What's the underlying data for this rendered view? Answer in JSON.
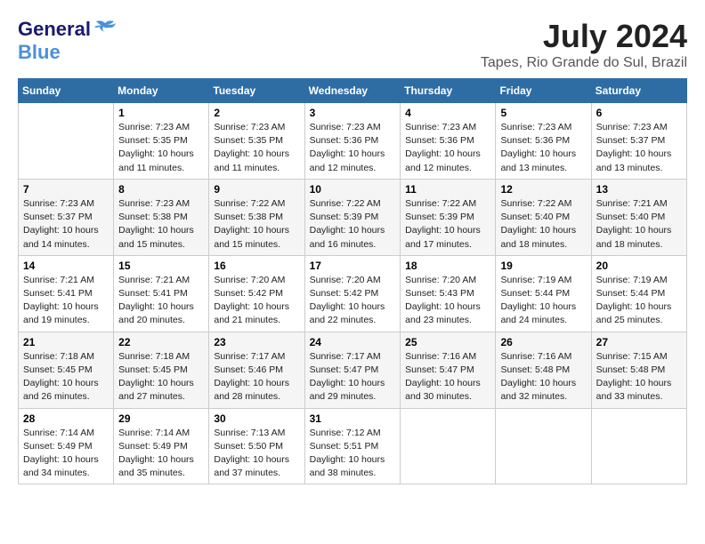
{
  "header": {
    "logo_general": "General",
    "logo_blue": "Blue",
    "month_year": "July 2024",
    "location": "Tapes, Rio Grande do Sul, Brazil"
  },
  "columns": [
    "Sunday",
    "Monday",
    "Tuesday",
    "Wednesday",
    "Thursday",
    "Friday",
    "Saturday"
  ],
  "weeks": [
    [
      {
        "day": "",
        "info": ""
      },
      {
        "day": "1",
        "info": "Sunrise: 7:23 AM\nSunset: 5:35 PM\nDaylight: 10 hours\nand 11 minutes."
      },
      {
        "day": "2",
        "info": "Sunrise: 7:23 AM\nSunset: 5:35 PM\nDaylight: 10 hours\nand 11 minutes."
      },
      {
        "day": "3",
        "info": "Sunrise: 7:23 AM\nSunset: 5:36 PM\nDaylight: 10 hours\nand 12 minutes."
      },
      {
        "day": "4",
        "info": "Sunrise: 7:23 AM\nSunset: 5:36 PM\nDaylight: 10 hours\nand 12 minutes."
      },
      {
        "day": "5",
        "info": "Sunrise: 7:23 AM\nSunset: 5:36 PM\nDaylight: 10 hours\nand 13 minutes."
      },
      {
        "day": "6",
        "info": "Sunrise: 7:23 AM\nSunset: 5:37 PM\nDaylight: 10 hours\nand 13 minutes."
      }
    ],
    [
      {
        "day": "7",
        "info": "Sunrise: 7:23 AM\nSunset: 5:37 PM\nDaylight: 10 hours\nand 14 minutes."
      },
      {
        "day": "8",
        "info": "Sunrise: 7:23 AM\nSunset: 5:38 PM\nDaylight: 10 hours\nand 15 minutes."
      },
      {
        "day": "9",
        "info": "Sunrise: 7:22 AM\nSunset: 5:38 PM\nDaylight: 10 hours\nand 15 minutes."
      },
      {
        "day": "10",
        "info": "Sunrise: 7:22 AM\nSunset: 5:39 PM\nDaylight: 10 hours\nand 16 minutes."
      },
      {
        "day": "11",
        "info": "Sunrise: 7:22 AM\nSunset: 5:39 PM\nDaylight: 10 hours\nand 17 minutes."
      },
      {
        "day": "12",
        "info": "Sunrise: 7:22 AM\nSunset: 5:40 PM\nDaylight: 10 hours\nand 18 minutes."
      },
      {
        "day": "13",
        "info": "Sunrise: 7:21 AM\nSunset: 5:40 PM\nDaylight: 10 hours\nand 18 minutes."
      }
    ],
    [
      {
        "day": "14",
        "info": "Sunrise: 7:21 AM\nSunset: 5:41 PM\nDaylight: 10 hours\nand 19 minutes."
      },
      {
        "day": "15",
        "info": "Sunrise: 7:21 AM\nSunset: 5:41 PM\nDaylight: 10 hours\nand 20 minutes."
      },
      {
        "day": "16",
        "info": "Sunrise: 7:20 AM\nSunset: 5:42 PM\nDaylight: 10 hours\nand 21 minutes."
      },
      {
        "day": "17",
        "info": "Sunrise: 7:20 AM\nSunset: 5:42 PM\nDaylight: 10 hours\nand 22 minutes."
      },
      {
        "day": "18",
        "info": "Sunrise: 7:20 AM\nSunset: 5:43 PM\nDaylight: 10 hours\nand 23 minutes."
      },
      {
        "day": "19",
        "info": "Sunrise: 7:19 AM\nSunset: 5:44 PM\nDaylight: 10 hours\nand 24 minutes."
      },
      {
        "day": "20",
        "info": "Sunrise: 7:19 AM\nSunset: 5:44 PM\nDaylight: 10 hours\nand 25 minutes."
      }
    ],
    [
      {
        "day": "21",
        "info": "Sunrise: 7:18 AM\nSunset: 5:45 PM\nDaylight: 10 hours\nand 26 minutes."
      },
      {
        "day": "22",
        "info": "Sunrise: 7:18 AM\nSunset: 5:45 PM\nDaylight: 10 hours\nand 27 minutes."
      },
      {
        "day": "23",
        "info": "Sunrise: 7:17 AM\nSunset: 5:46 PM\nDaylight: 10 hours\nand 28 minutes."
      },
      {
        "day": "24",
        "info": "Sunrise: 7:17 AM\nSunset: 5:47 PM\nDaylight: 10 hours\nand 29 minutes."
      },
      {
        "day": "25",
        "info": "Sunrise: 7:16 AM\nSunset: 5:47 PM\nDaylight: 10 hours\nand 30 minutes."
      },
      {
        "day": "26",
        "info": "Sunrise: 7:16 AM\nSunset: 5:48 PM\nDaylight: 10 hours\nand 32 minutes."
      },
      {
        "day": "27",
        "info": "Sunrise: 7:15 AM\nSunset: 5:48 PM\nDaylight: 10 hours\nand 33 minutes."
      }
    ],
    [
      {
        "day": "28",
        "info": "Sunrise: 7:14 AM\nSunset: 5:49 PM\nDaylight: 10 hours\nand 34 minutes."
      },
      {
        "day": "29",
        "info": "Sunrise: 7:14 AM\nSunset: 5:49 PM\nDaylight: 10 hours\nand 35 minutes."
      },
      {
        "day": "30",
        "info": "Sunrise: 7:13 AM\nSunset: 5:50 PM\nDaylight: 10 hours\nand 37 minutes."
      },
      {
        "day": "31",
        "info": "Sunrise: 7:12 AM\nSunset: 5:51 PM\nDaylight: 10 hours\nand 38 minutes."
      },
      {
        "day": "",
        "info": ""
      },
      {
        "day": "",
        "info": ""
      },
      {
        "day": "",
        "info": ""
      }
    ]
  ]
}
